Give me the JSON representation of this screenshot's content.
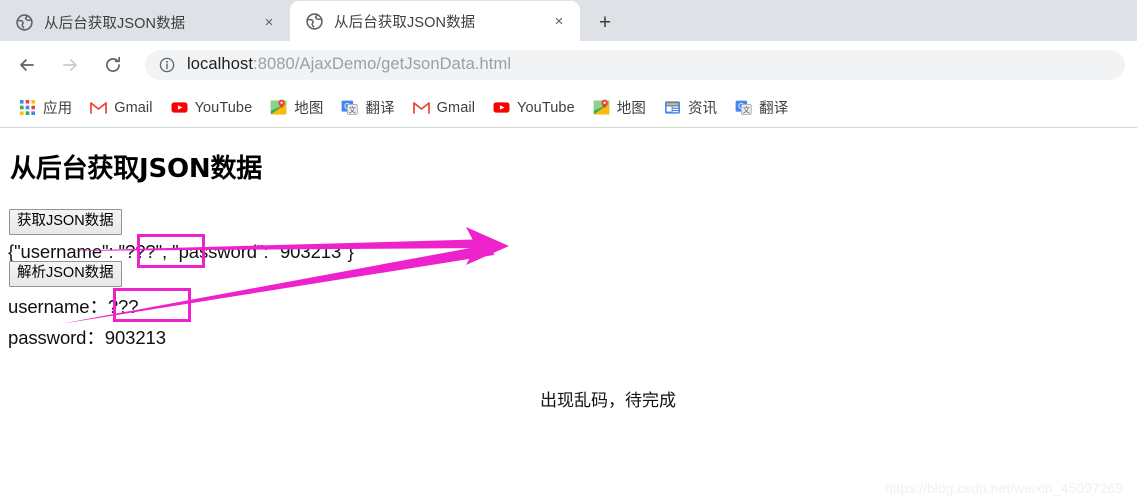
{
  "browser": {
    "tabs": [
      {
        "title": "从后台获取JSON数据",
        "favicon": "globe-icon",
        "close_label": "×",
        "active": false
      },
      {
        "title": "从后台获取JSON数据",
        "favicon": "globe-icon",
        "close_label": "×",
        "active": true
      }
    ],
    "new_tab_label": "+",
    "nav": {
      "back_label": "←",
      "forward_label": "→",
      "reload_label": "⟳"
    },
    "omnibox": {
      "security_icon": "info-circle-icon",
      "host": "localhost",
      "path": ":8080/AjaxDemo/getJsonData.html",
      "full_url": "localhost:8080/AjaxDemo/getJsonData.html"
    },
    "bookmarks": [
      {
        "label": "应用",
        "icon": "apps-grid-icon"
      },
      {
        "label": "Gmail",
        "icon": "gmail-icon"
      },
      {
        "label": "YouTube",
        "icon": "youtube-icon"
      },
      {
        "label": "地图",
        "icon": "maps-icon"
      },
      {
        "label": "翻译",
        "icon": "translate-icon"
      },
      {
        "label": "Gmail",
        "icon": "gmail-icon"
      },
      {
        "label": "YouTube",
        "icon": "youtube-icon"
      },
      {
        "label": "地图",
        "icon": "maps-icon"
      },
      {
        "label": "资讯",
        "icon": "news-icon"
      },
      {
        "label": "翻译",
        "icon": "translate-icon"
      }
    ]
  },
  "page": {
    "heading": "从后台获取JSON数据",
    "fetch_button": "获取JSON数据",
    "parse_button": "解析JSON数据",
    "json_output": "{\"username\": \"???\", \"password\": \"903213\"}",
    "username_line": "username：???",
    "password_line": "password：903213"
  },
  "annotations": {
    "note": "出现乱码，待完成",
    "highlight_color": "#ee22cc",
    "arrow_color": "#ee22cc"
  },
  "watermark": "https://blog.csdn.net/weixin_45097269"
}
